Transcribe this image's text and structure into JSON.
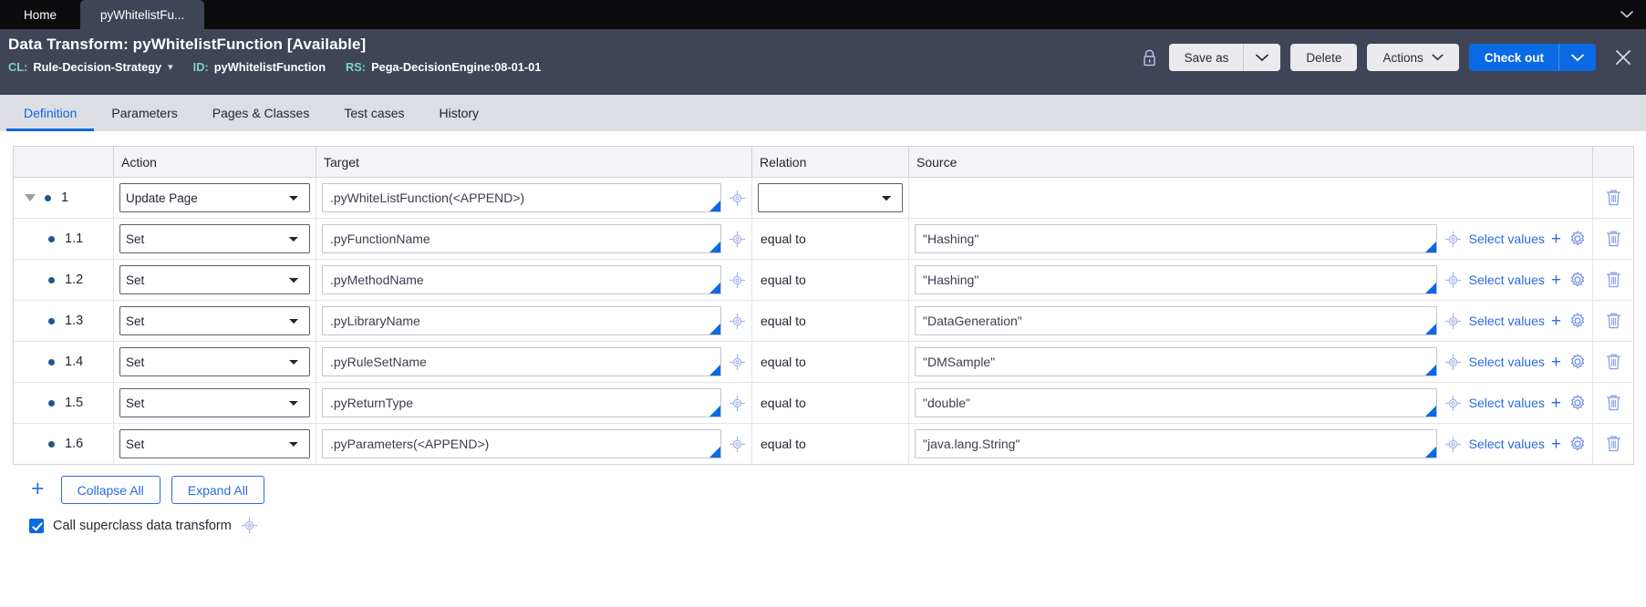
{
  "browser_tabs": {
    "items": [
      {
        "label": "Home",
        "active": false
      },
      {
        "label": "pyWhitelistFu...",
        "active": true
      }
    ],
    "overflow_icon": "chevron-down-icon"
  },
  "header": {
    "title_prefix": "Data Transform:",
    "rule_name": "pyWhitelistFunction",
    "status": "[Available]",
    "title_full": "Data Transform: pyWhitelistFunction [Available]",
    "meta": {
      "class_key": "CL:",
      "class_value": "Rule-Decision-Strategy",
      "id_key": "ID:",
      "id_value": "pyWhitelistFunction",
      "ruleset_key": "RS:",
      "ruleset_value": "Pega-DecisionEngine:08-01-01"
    },
    "actions": {
      "lock_icon": "lock-icon",
      "save_as_label": "Save as",
      "delete_label": "Delete",
      "actions_label": "Actions",
      "check_out_label": "Check out",
      "close_icon": "close-icon"
    },
    "colors": {
      "header_bg": "#3f4457",
      "accent_blue": "#0b69e3",
      "meta_key": "#7fd3c8"
    }
  },
  "nav_tabs": {
    "items": [
      {
        "label": "Definition",
        "active": true
      },
      {
        "label": "Parameters",
        "active": false
      },
      {
        "label": "Pages & Classes",
        "active": false
      },
      {
        "label": "Test cases",
        "active": false
      },
      {
        "label": "History",
        "active": false
      }
    ]
  },
  "table": {
    "columns": [
      "",
      "Action",
      "Target",
      "Relation",
      "Source",
      ""
    ],
    "rows": [
      {
        "number": "1",
        "expandable": true,
        "child": false,
        "action": "Update Page",
        "target": ".pyWhiteListFunction(<APPEND>)",
        "relation_select": "",
        "relation_text": "",
        "source": "",
        "has_source_field": false,
        "has_select_values": false,
        "select_values_label": "",
        "delete_icon": "trash-icon"
      },
      {
        "number": "1.1",
        "expandable": false,
        "child": true,
        "action": "Set",
        "target": ".pyFunctionName",
        "relation_text": "equal to",
        "source": "\"Hashing\"",
        "has_source_field": true,
        "has_select_values": true,
        "select_values_label": "Select values",
        "delete_icon": "trash-icon"
      },
      {
        "number": "1.2",
        "expandable": false,
        "child": true,
        "action": "Set",
        "target": ".pyMethodName",
        "relation_text": "equal to",
        "source": "\"Hashing\"",
        "has_source_field": true,
        "has_select_values": true,
        "select_values_label": "Select values",
        "delete_icon": "trash-icon"
      },
      {
        "number": "1.3",
        "expandable": false,
        "child": true,
        "action": "Set",
        "target": ".pyLibraryName",
        "relation_text": "equal to",
        "source": "\"DataGeneration\"",
        "has_source_field": true,
        "has_select_values": true,
        "select_values_label": "Select values",
        "delete_icon": "trash-icon"
      },
      {
        "number": "1.4",
        "expandable": false,
        "child": true,
        "action": "Set",
        "target": ".pyRuleSetName",
        "relation_text": "equal to",
        "source": "\"DMSample\"",
        "has_source_field": true,
        "has_select_values": true,
        "select_values_label": "Select values",
        "delete_icon": "trash-icon"
      },
      {
        "number": "1.5",
        "expandable": false,
        "child": true,
        "action": "Set",
        "target": ".pyReturnType",
        "relation_text": "equal to",
        "source": "\"double\"",
        "has_source_field": true,
        "has_select_values": true,
        "select_values_label": "Select values",
        "delete_icon": "trash-icon"
      },
      {
        "number": "1.6",
        "expandable": false,
        "child": true,
        "action": "Set",
        "target": ".pyParameters(<APPEND>)",
        "relation_text": "equal to",
        "source": "\"java.lang.String\"",
        "has_source_field": true,
        "has_select_values": true,
        "select_values_label": "Select values",
        "delete_icon": "trash-icon"
      }
    ]
  },
  "footer": {
    "add_row_icon": "plus-icon",
    "collapse_all_label": "Collapse All",
    "expand_all_label": "Expand All",
    "checkbox_checked": true,
    "checkbox_label": "Call superclass data transform",
    "checkbox_help_icon": "target-icon"
  }
}
